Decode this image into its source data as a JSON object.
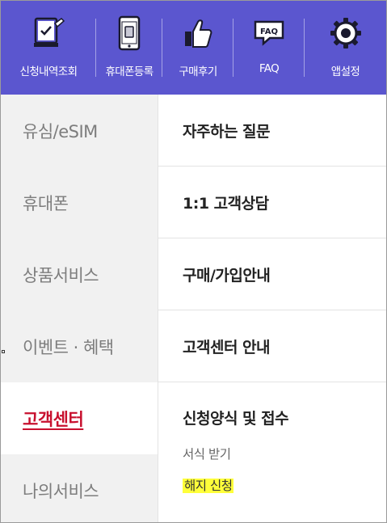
{
  "topbar": {
    "color": "#5b56cf",
    "items": [
      {
        "label": "신청내역조회",
        "icon": "clipboard-check-icon"
      },
      {
        "label": "휴대폰등록",
        "icon": "phone-sim-icon"
      },
      {
        "label": "구매후기",
        "icon": "thumbs-up-icon"
      },
      {
        "label": "FAQ",
        "icon": "faq-bubble-icon"
      },
      {
        "label": "앱설정",
        "icon": "gear-icon"
      }
    ]
  },
  "left_menu": {
    "active_color": "#c8102e",
    "items": [
      {
        "label": "유심/eSIM"
      },
      {
        "label": "휴대폰"
      },
      {
        "label": "상품서비스"
      },
      {
        "label": "이벤트 · 혜택"
      },
      {
        "label": "고객센터",
        "active": true
      },
      {
        "label": "나의서비스"
      }
    ]
  },
  "right_menu": {
    "items": [
      {
        "label": "자주하는 질문"
      },
      {
        "label": "1:1 고객상담"
      },
      {
        "label": "구매/가입안내"
      },
      {
        "label": "고객센터 안내"
      },
      {
        "label": "신청양식 및 접수",
        "sub_items": [
          {
            "label": "서식 받기"
          },
          {
            "label": "해지 신청",
            "highlighted": true
          }
        ]
      }
    ]
  }
}
